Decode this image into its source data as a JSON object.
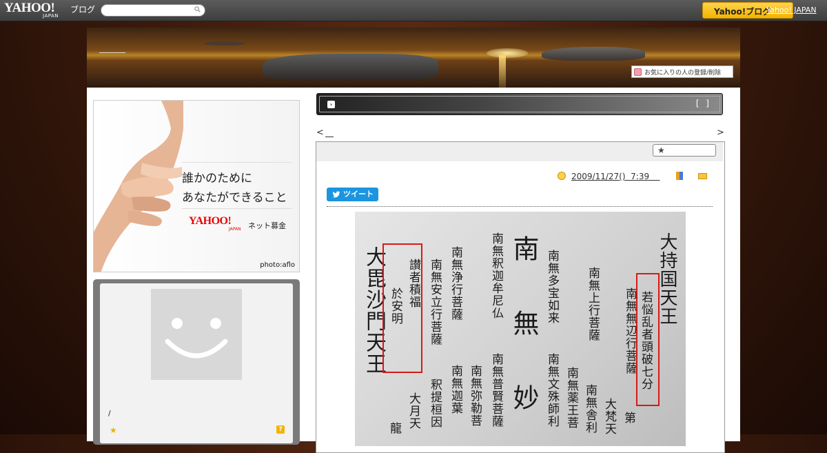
{
  "topbar": {
    "logo": "YAHOO!",
    "logo_sub": "JAPAN",
    "blog_label": "ブログ",
    "search_placeholder": "",
    "yahoo_button": "Yahoo!ブログ",
    "yahoo_japan_link": "Yahoo! JAPAN"
  },
  "header": {
    "favorite_button": "お気に入りの人の登録/削除"
  },
  "ad": {
    "line1": "誰かのために",
    "line2": "あなたができること",
    "logo": "YAHOO!",
    "logo_sub": "JAPAN",
    "donate": "ネット募金",
    "credit": "photo:aflo"
  },
  "profile": {
    "slash": "/"
  },
  "bar": {
    "brackets": "[ ]"
  },
  "nav": {
    "prev": "<",
    "next": ">"
  },
  "article": {
    "date": "2009/11/27()  7:39    ",
    "tweet": "ツイート",
    "image_columns": [
      "大持国天王",
      "若悩乱者頭破七分",
      "南無無辺行菩薩",
      "第",
      "南無上行菩薩",
      "大梵天",
      "南無多宝如来",
      "南無舎利",
      "南無薬王菩",
      "南無文殊師利",
      "南",
      "無",
      "妙",
      "南無釈迦牟尼仏",
      "南無普賢菩薩",
      "南無弥勒菩",
      "南無浄行菩薩",
      "南無迦葉",
      "南無安立行菩薩",
      "釈提桓因",
      "讃者積福",
      "於安明",
      "大月天",
      "大毘沙門天王",
      "龍"
    ]
  },
  "colors": {
    "accent": "#f5b400",
    "tweet": "#1b95e0",
    "highlight": "#d81818"
  }
}
